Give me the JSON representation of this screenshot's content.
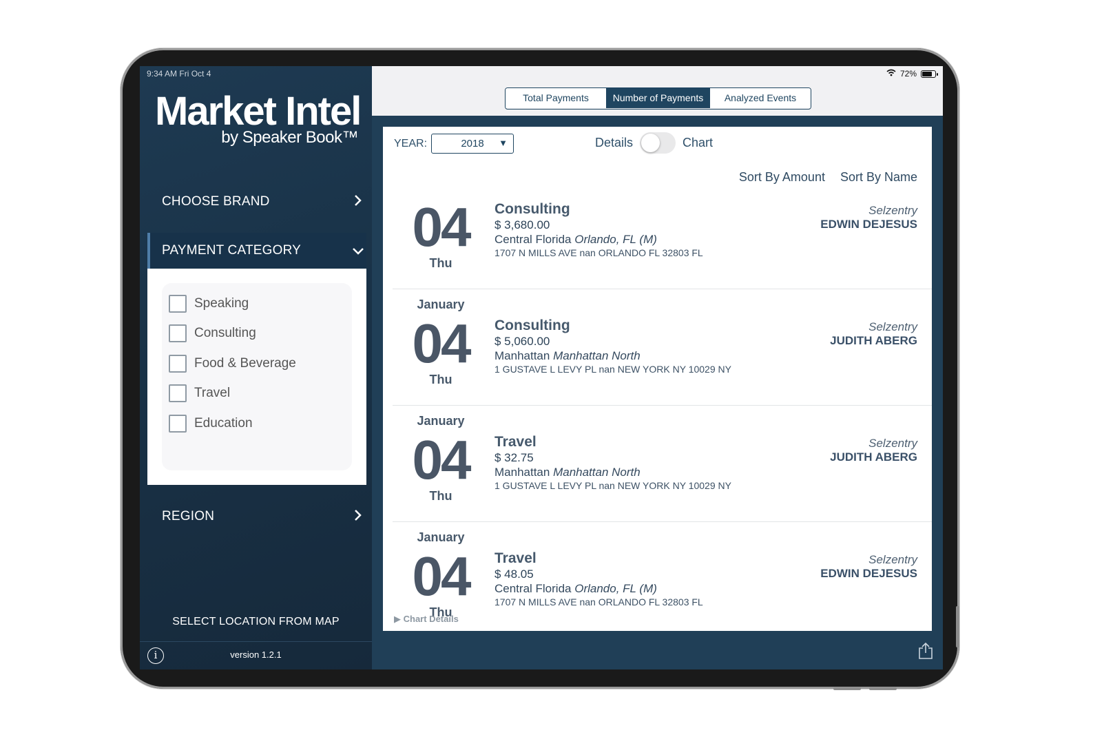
{
  "status": {
    "time": "9:34 AM   Fri Oct 4",
    "battery": "72%"
  },
  "sidebar": {
    "title": "Market Intel",
    "subtitle": "by Speaker Book™",
    "choose_brand": "CHOOSE BRAND",
    "payment_category": "PAYMENT CATEGORY",
    "categories": [
      "Speaking",
      "Consulting",
      "Food & Beverage",
      "Travel",
      "Education"
    ],
    "region": "REGION",
    "select_location": "SELECT LOCATION FROM MAP",
    "version": "version 1.2.1"
  },
  "tabs": {
    "total": "Total Payments",
    "number": "Number of Payments",
    "events": "Analyzed Events",
    "active": "Number of Payments"
  },
  "filters": {
    "year_label": "YEAR:",
    "year_value": "2018",
    "details_label": "Details",
    "chart_label": "Chart",
    "sort_amount": "Sort By Amount",
    "sort_name": "Sort By Name"
  },
  "entries": [
    {
      "month": "",
      "day": "04",
      "weekday": "Thu",
      "category": "Consulting",
      "amount": "$ 3,680.00",
      "location": "Central Florida",
      "location_detail": "Orlando, FL (M)",
      "address": "1707 N MILLS AVE nan ORLANDO FL 32803 FL",
      "brand": "Selzentry",
      "person": "EDWIN DEJESUS"
    },
    {
      "month": "January",
      "day": "04",
      "weekday": "Thu",
      "category": "Consulting",
      "amount": "$ 5,060.00",
      "location": "Manhattan",
      "location_detail": "Manhattan North",
      "address": "1 GUSTAVE L LEVY PL nan NEW YORK NY 10029 NY",
      "brand": "Selzentry",
      "person": "JUDITH ABERG"
    },
    {
      "month": "January",
      "day": "04",
      "weekday": "Thu",
      "category": "Travel",
      "amount": "$ 32.75",
      "location": "Manhattan",
      "location_detail": "Manhattan North",
      "address": "1 GUSTAVE L LEVY PL nan NEW YORK NY 10029 NY",
      "brand": "Selzentry",
      "person": "JUDITH ABERG"
    },
    {
      "month": "January",
      "day": "04",
      "weekday": "Thu",
      "category": "Travel",
      "amount": "$ 48.05",
      "location": "Central Florida",
      "location_detail": "Orlando, FL (M)",
      "address": "1707 N MILLS AVE nan ORLANDO FL 32803 FL",
      "brand": "Selzentry",
      "person": "EDWIN DEJESUS"
    }
  ],
  "chart_details": "Chart Details",
  "icons": {
    "chevron_right": "chevron-right-icon",
    "chevron_down": "chevron-down-icon",
    "info": "info-icon",
    "share": "share-icon",
    "wifi": "wifi-icon",
    "battery": "battery-icon"
  },
  "colors": {
    "sidebar": "#1e3a52",
    "accent": "#1f4560",
    "content_bg": "#203f57"
  }
}
